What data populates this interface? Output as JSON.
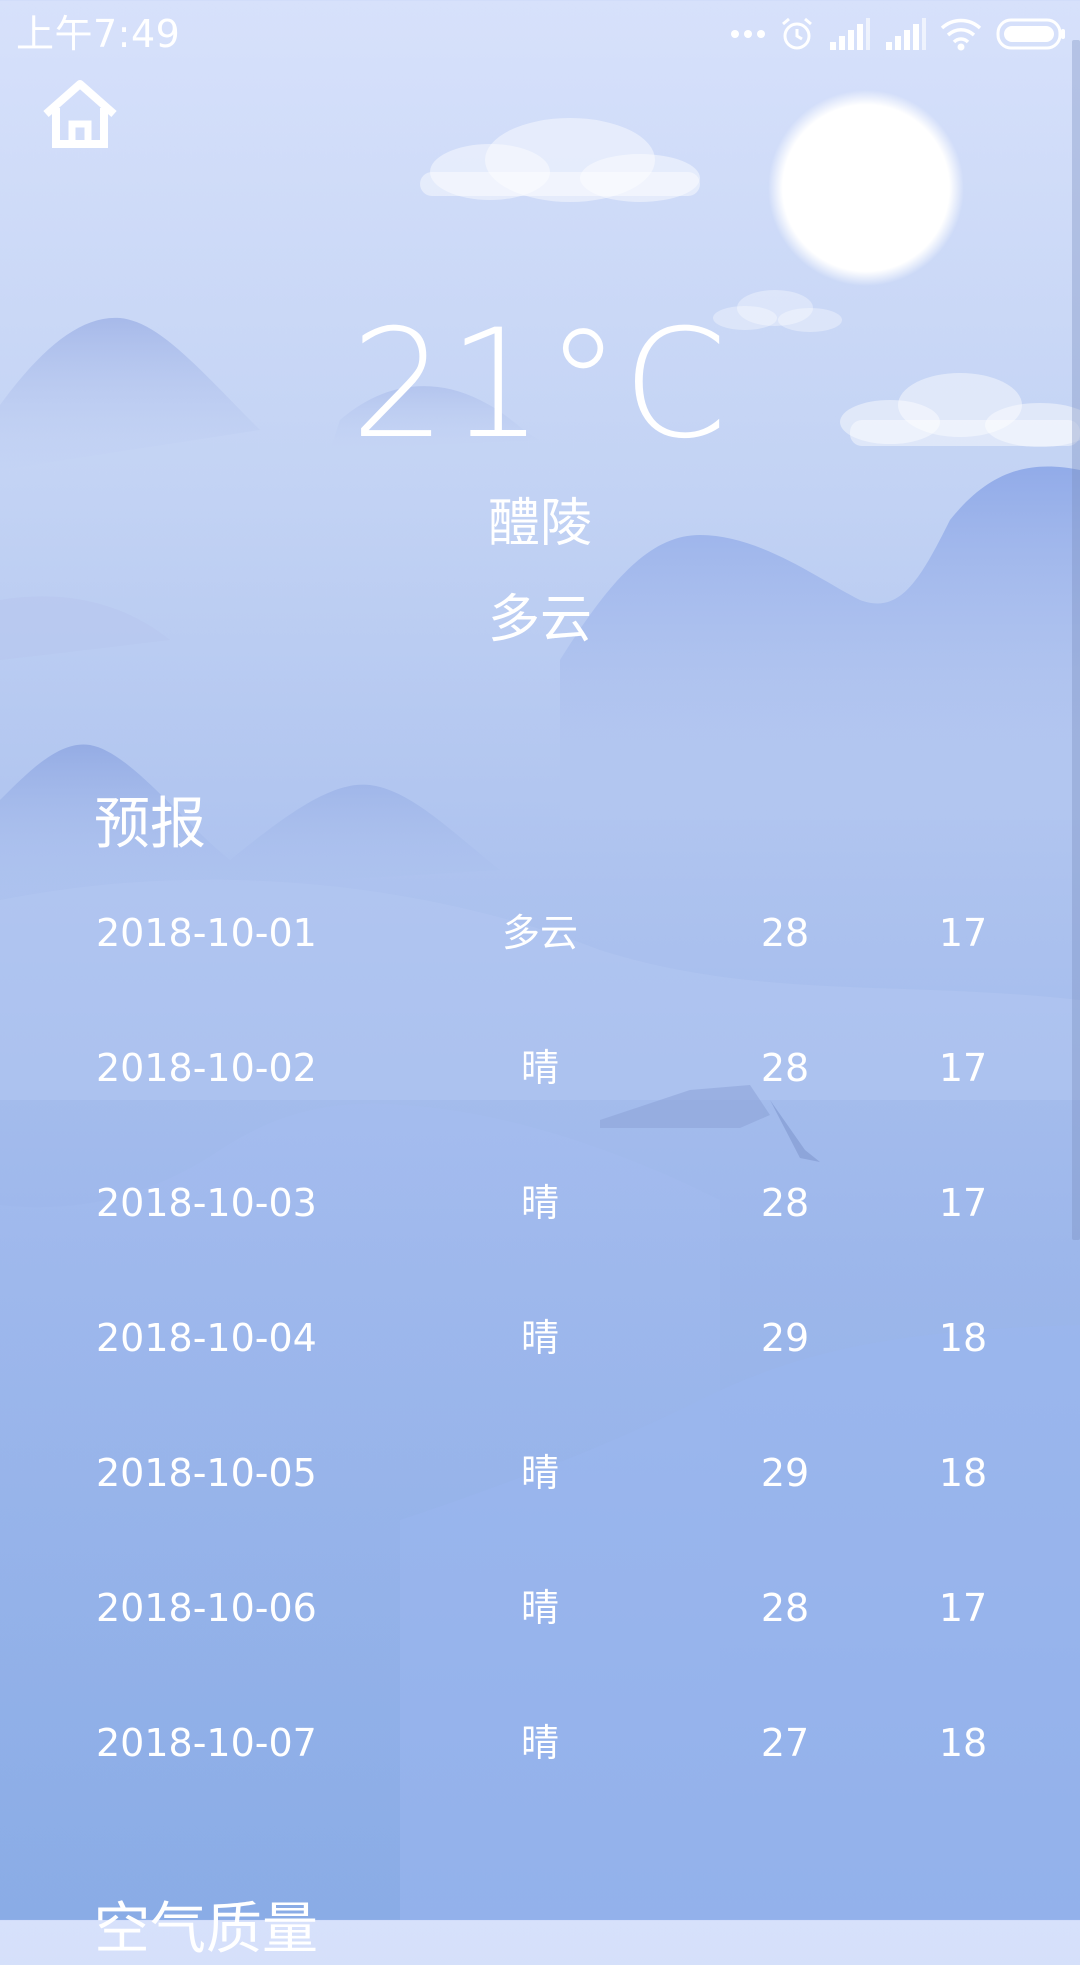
{
  "status_bar": {
    "time": "上午7:49",
    "icons": [
      "more-dots-icon",
      "alarm-icon",
      "signal-icon",
      "signal-icon",
      "wifi-icon",
      "battery-icon"
    ]
  },
  "header": {
    "home_icon": "home-icon"
  },
  "current": {
    "temperature": "21°C",
    "city": "醴陵",
    "condition": "多云"
  },
  "forecast": {
    "title": "预报",
    "rows": [
      {
        "date": "2018-10-01",
        "condition": "多云",
        "high": "28",
        "low": "17"
      },
      {
        "date": "2018-10-02",
        "condition": "晴",
        "high": "28",
        "low": "17"
      },
      {
        "date": "2018-10-03",
        "condition": "晴",
        "high": "28",
        "low": "17"
      },
      {
        "date": "2018-10-04",
        "condition": "晴",
        "high": "29",
        "low": "18"
      },
      {
        "date": "2018-10-05",
        "condition": "晴",
        "high": "29",
        "low": "18"
      },
      {
        "date": "2018-10-06",
        "condition": "晴",
        "high": "28",
        "low": "17"
      },
      {
        "date": "2018-10-07",
        "condition": "晴",
        "high": "27",
        "low": "18"
      }
    ]
  },
  "air_quality": {
    "title": "空气质量"
  },
  "colors": {
    "text": "#ffffff",
    "sky_top": "#d7e1fb",
    "sky_bottom": "#8aace6"
  }
}
